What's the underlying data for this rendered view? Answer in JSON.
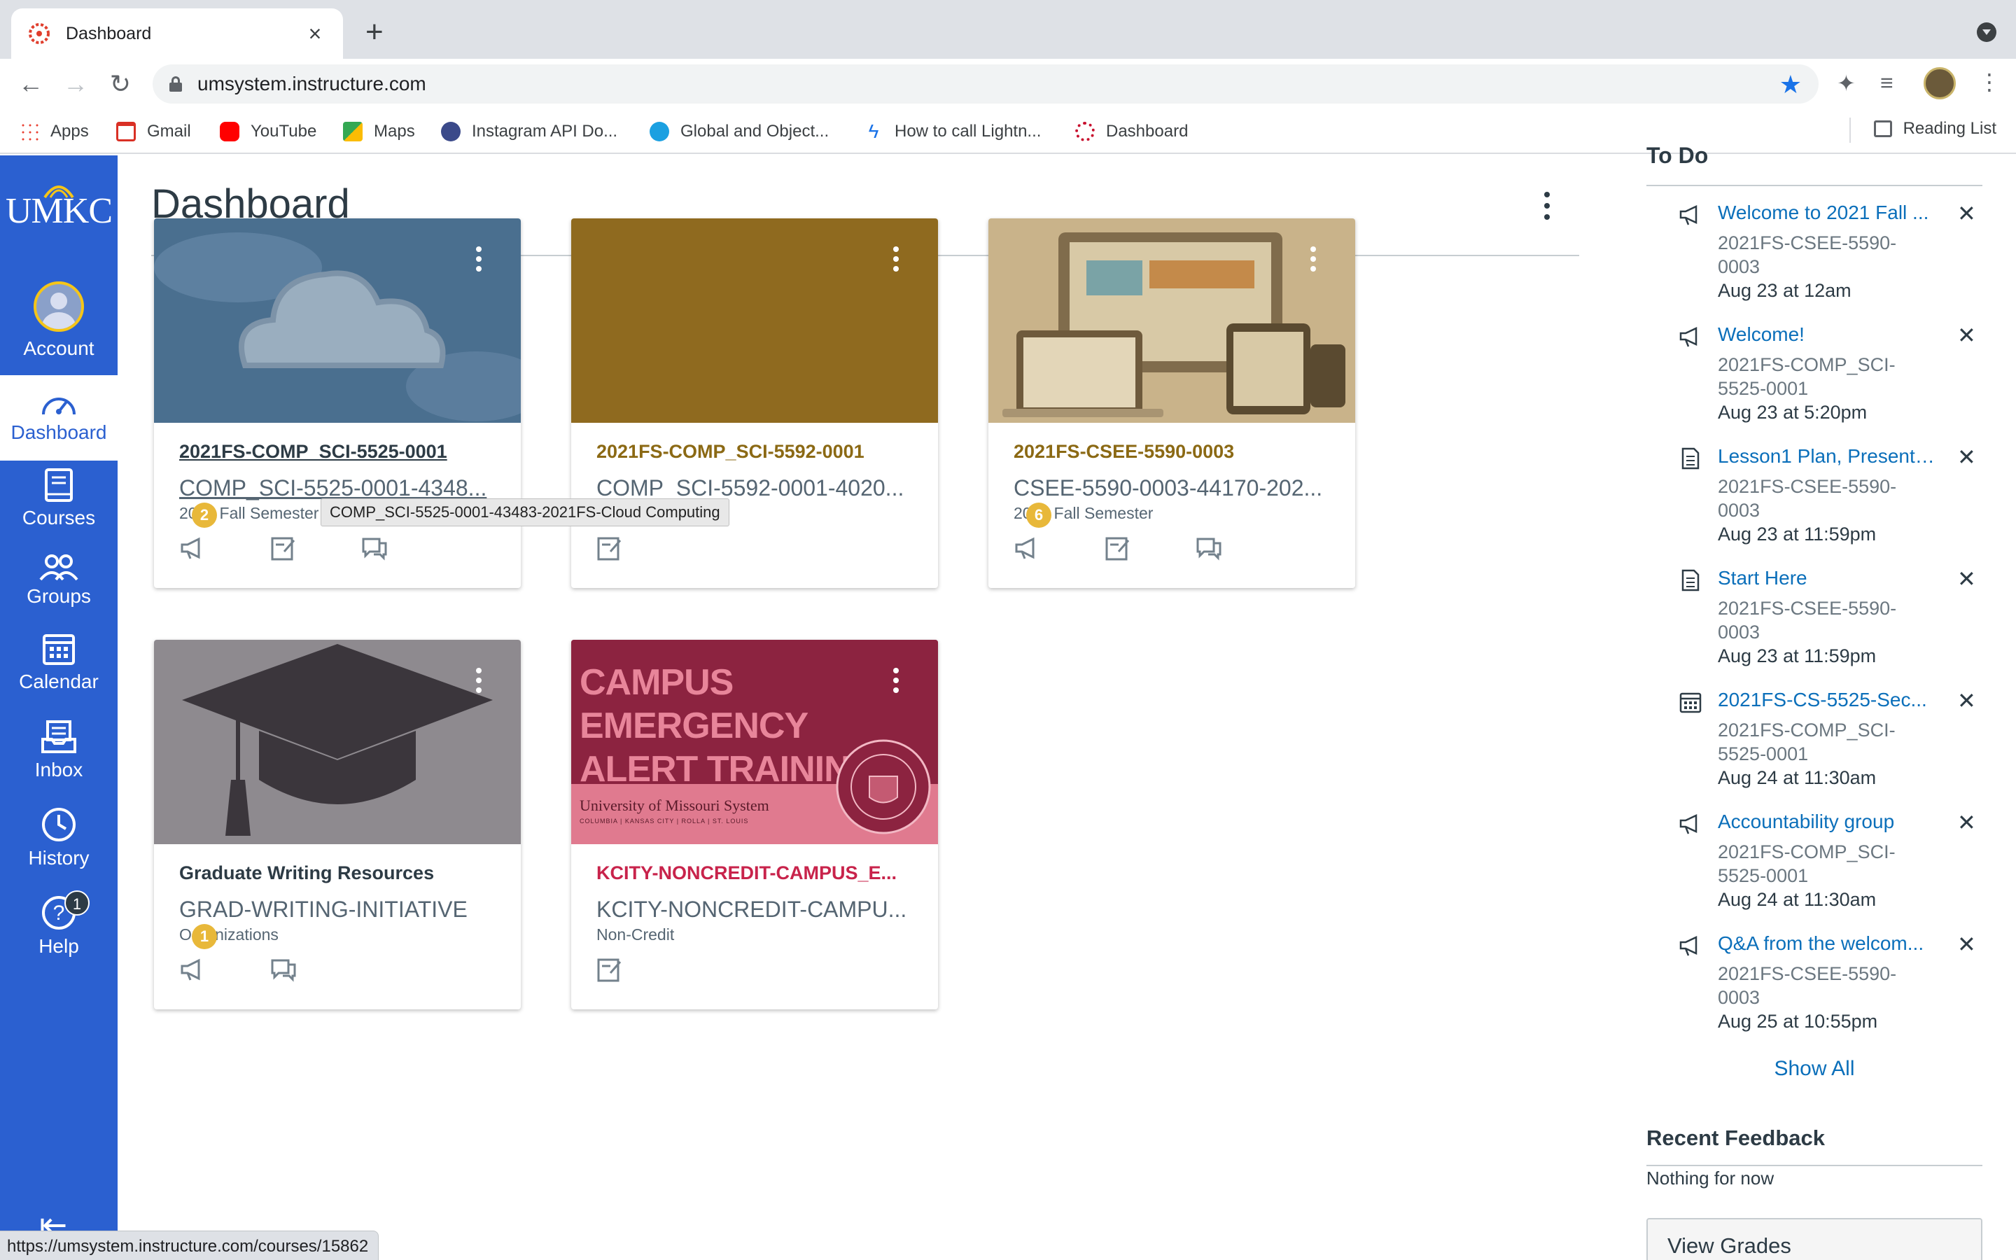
{
  "browser": {
    "tab_title": "Dashboard",
    "url": "umsystem.instructure.com",
    "bookmarks": [
      {
        "label": "Apps",
        "color": "#ea4335"
      },
      {
        "label": "Gmail",
        "color": "#d93025"
      },
      {
        "label": "YouTube",
        "color": "#ff0000"
      },
      {
        "label": "Maps",
        "color": "#34a853"
      },
      {
        "label": "Instagram API Do...",
        "color": "#3b4a8a"
      },
      {
        "label": "Global and Object...",
        "color": "#1ba0e1"
      },
      {
        "label": "How to call Lightn...",
        "color": "#1a73e8"
      },
      {
        "label": "Dashboard",
        "color": "#c8102e"
      }
    ],
    "reading_list": "Reading List",
    "status_url": "https://umsystem.instructure.com/courses/15862"
  },
  "gnav": {
    "logo": "UMKC",
    "items": [
      {
        "label": "Account"
      },
      {
        "label": "Dashboard"
      },
      {
        "label": "Courses"
      },
      {
        "label": "Groups"
      },
      {
        "label": "Calendar"
      },
      {
        "label": "Inbox"
      },
      {
        "label": "History"
      },
      {
        "label": "Help"
      }
    ],
    "help_badge": "1"
  },
  "main": {
    "title": "Dashboard",
    "tooltip": "COMP_SCI-5525-0001-43483-2021FS-Cloud Computing",
    "cards": [
      {
        "title": "2021FS-COMP_SCI-5525-0001",
        "code": "COMP_SCI-5525-0001-4348...",
        "term": "2021 Fall Semester",
        "color": "#2d3b45",
        "hero_color": "#4a6f8f",
        "badge": "2"
      },
      {
        "title": "2021FS-COMP_SCI-5592-0001",
        "code": "COMP_SCI-5592-0001-4020...",
        "term": "",
        "color": "#8b6914",
        "hero_color": "#8f6a1f",
        "badge": ""
      },
      {
        "title": "2021FS-CSEE-5590-0003",
        "code": "CSEE-5590-0003-44170-202...",
        "term": "2021 Fall Semester",
        "color": "#8b6914",
        "hero_color": "#c9b38a",
        "badge": "6"
      },
      {
        "title": "Graduate Writing Resources",
        "code": "GRAD-WRITING-INITIATIVE",
        "term": "Organizations",
        "color": "#2d3b45",
        "hero_color": "#8e8a8f",
        "badge": "1"
      },
      {
        "title": "KCITY-NONCREDIT-CAMPUS_E...",
        "code": "KCITY-NONCREDIT-CAMPU...",
        "term": "Non-Credit",
        "color": "#c8234b",
        "hero_color": "#8c2340",
        "badge": ""
      }
    ],
    "campus_banner": {
      "line1": "CAMPUS EMERGENCY",
      "line2": "ALERT TRAINING",
      "org": "University of Missouri System",
      "sub": "COLUMBIA | KANSAS CITY | ROLLA | ST. LOUIS"
    }
  },
  "todo": {
    "heading": "To Do",
    "items": [
      {
        "icon": "announcement-icon",
        "title": "Welcome to 2021 Fall ...",
        "course": "2021FS-CSEE-5590-0003",
        "date": "Aug 23 at 12am"
      },
      {
        "icon": "announcement-icon",
        "title": "Welcome!",
        "course": "2021FS-COMP_SCI-5525-0001",
        "date": "Aug 23 at 5:20pm"
      },
      {
        "icon": "document-icon",
        "title": "Lesson1 Plan, Presenta...",
        "course": "2021FS-CSEE-5590-0003",
        "date": "Aug 23 at 11:59pm"
      },
      {
        "icon": "document-icon",
        "title": "Start Here",
        "course": "2021FS-CSEE-5590-0003",
        "date": "Aug 23 at 11:59pm"
      },
      {
        "icon": "calendar-icon",
        "title": "2021FS-CS-5525-Sec...",
        "course": "2021FS-COMP_SCI-5525-0001",
        "date": "Aug 24 at 11:30am"
      },
      {
        "icon": "announcement-icon",
        "title": "Accountability group",
        "course": "2021FS-COMP_SCI-5525-0001",
        "date": "Aug 24 at 11:30am"
      },
      {
        "icon": "announcement-icon",
        "title": "Q&A from the welcom...",
        "course": "2021FS-CSEE-5590-0003",
        "date": "Aug 25 at 10:55pm"
      }
    ],
    "show_all": "Show All",
    "recent_feedback": "Recent Feedback",
    "nothing": "Nothing for now",
    "view_grades": "View Grades"
  }
}
